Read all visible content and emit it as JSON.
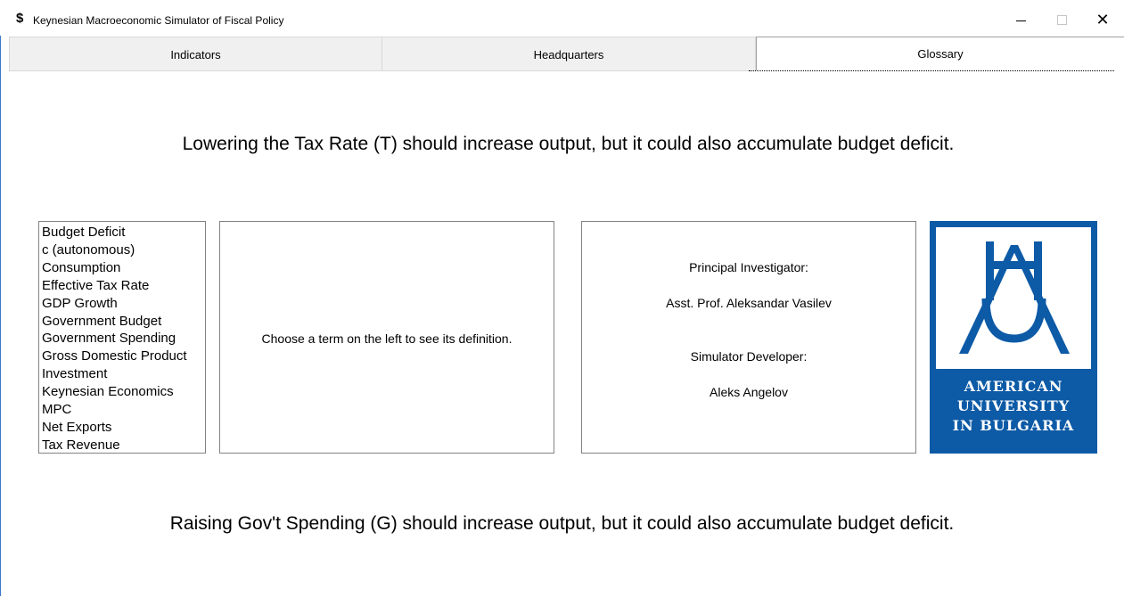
{
  "window": {
    "icon_glyph": "$",
    "icon_name": "dollar-icon",
    "title": "Keynesian Macroeconomic Simulator of Fiscal Policy",
    "minimize_glyph": "",
    "maximize_glyph": "",
    "close_glyph": "✕"
  },
  "tabs": [
    {
      "label": "Indicators",
      "selected": false
    },
    {
      "label": "Headquarters",
      "selected": false
    },
    {
      "label": "Glossary",
      "selected": true
    }
  ],
  "messages": {
    "top": "Lowering the Tax Rate (T) should increase output, but it could also accumulate budget deficit.",
    "bottom": "Raising Gov't Spending (G) should increase output, but it could also accumulate budget deficit."
  },
  "glossary": {
    "terms": [
      "Budget Deficit",
      "c (autonomous)",
      "Consumption",
      "Effective Tax Rate",
      "GDP Growth",
      "Government Budget",
      "Government Spending",
      "Gross Domestic Product",
      "Investment",
      "Keynesian Economics",
      "MPC",
      "Net Exports",
      "Tax Revenue"
    ],
    "definition_prompt": "Choose a term on the left to see its definition."
  },
  "credits": {
    "pi_label": "Principal Investigator:",
    "pi_name": "Asst. Prof. Aleksandar Vasilev",
    "dev_label": "Simulator Developer:",
    "dev_name": "Aleks Angelov"
  },
  "logo": {
    "line1": "AMERICAN",
    "line2": "UNIVERSITY",
    "line3": "IN BULGARIA",
    "brand_color": "#0d5aa6"
  }
}
